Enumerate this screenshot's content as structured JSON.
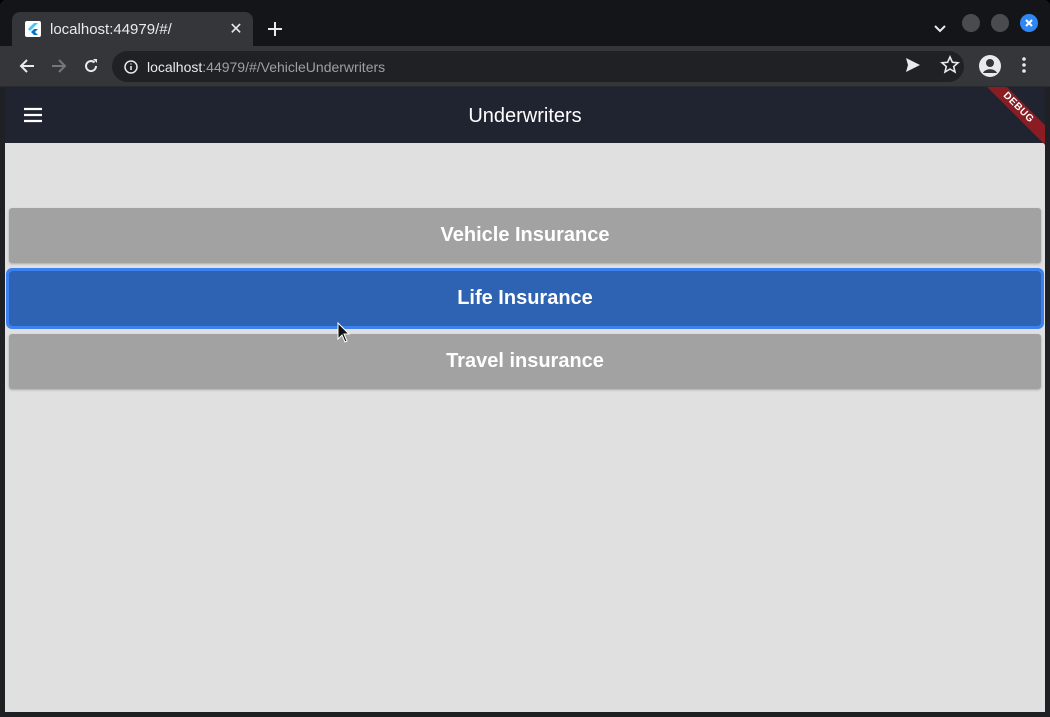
{
  "browser": {
    "tab_title": "localhost:44979/#/",
    "url_host": "localhost",
    "url_rest": ":44979/#/VehicleUnderwriters"
  },
  "app": {
    "title": "Underwriters",
    "debug_label": "DEBUG",
    "buttons": [
      {
        "label": "Vehicle Insurance",
        "selected": false
      },
      {
        "label": "Life Insurance",
        "selected": true
      },
      {
        "label": "Travel insurance",
        "selected": false
      }
    ]
  },
  "colors": {
    "appbar": "#202330",
    "background": "#e0e0e0",
    "button_default": "#a2a2a2",
    "button_selected": "#2e62b2"
  }
}
